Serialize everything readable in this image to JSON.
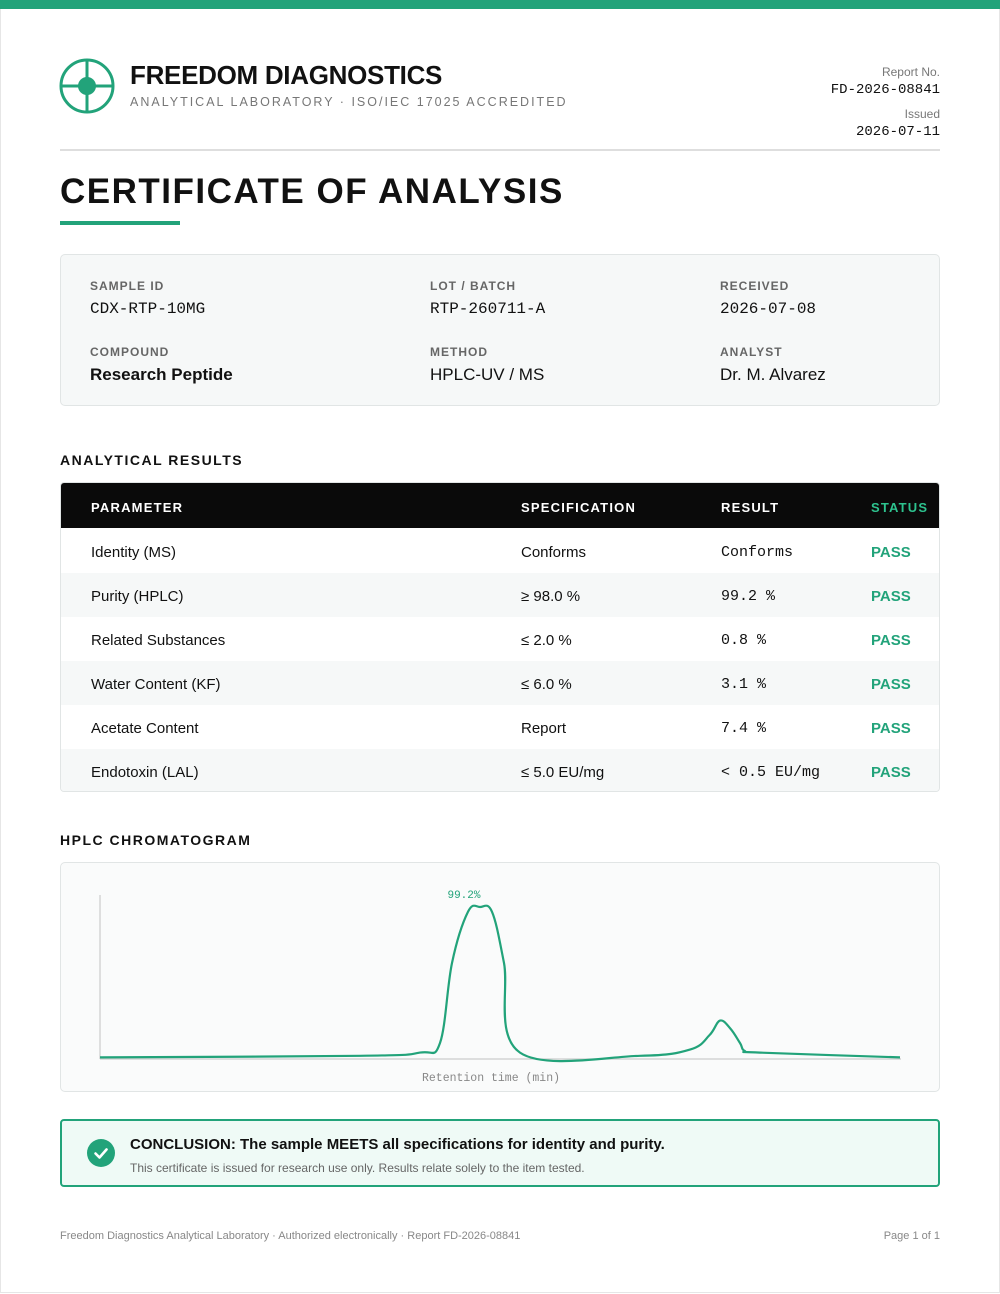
{
  "colors": {
    "accent": "#22a37a",
    "header_dark": "#0a0a0a",
    "pass": "#22a37a"
  },
  "header": {
    "brand_name": "FREEDOM DIAGNOSTICS",
    "brand_sub": "ANALYTICAL LABORATORY · ISO/IEC 17025 ACCREDITED",
    "logo_icon": "crosshair-icon",
    "report_no_label": "Report No.",
    "report_no": "FD-2026-08841",
    "issued_label": "Issued",
    "issued": "2026-07-11"
  },
  "title": "CERTIFICATE OF ANALYSIS",
  "sample": {
    "sample_id_label": "SAMPLE ID",
    "sample_id": "CDX-RTP-10MG",
    "lot_label": "LOT / BATCH",
    "lot": "RTP-260711-A",
    "received_label": "RECEIVED",
    "received": "2026-07-08",
    "compound_label": "COMPOUND",
    "compound": "Research Peptide",
    "method_label": "METHOD",
    "method": "HPLC-UV / MS",
    "analyst_label": "ANALYST",
    "analyst": "Dr. M. Alvarez"
  },
  "results": {
    "section_title": "ANALYTICAL RESULTS",
    "headers": [
      "PARAMETER",
      "SPECIFICATION",
      "RESULT",
      "STATUS"
    ],
    "rows": [
      {
        "parameter": "Identity (MS)",
        "spec": "Conforms",
        "result": "Conforms",
        "status": "PASS"
      },
      {
        "parameter": "Purity (HPLC)",
        "spec": "≥ 98.0 %",
        "result": "99.2 %",
        "status": "PASS"
      },
      {
        "parameter": "Related Substances",
        "spec": "≤ 2.0 %",
        "result": "0.8 %",
        "status": "PASS"
      },
      {
        "parameter": "Water Content (KF)",
        "spec": "≤ 6.0 %",
        "result": "3.1 %",
        "status": "PASS"
      },
      {
        "parameter": "Acetate Content",
        "spec": "Report",
        "result": "7.4 %",
        "status": "PASS"
      },
      {
        "parameter": "Endotoxin (LAL)",
        "spec": "≤ 5.0 EU/mg",
        "result": "< 0.5 EU/mg",
        "status": "PASS"
      }
    ]
  },
  "chromatogram": {
    "section_title": "HPLC CHROMATOGRAM"
  },
  "chart_data": {
    "type": "line",
    "title": "",
    "xlabel": "Retention time (min)",
    "ylabel": "",
    "grid": false,
    "peak_label": "99.2%",
    "x": [
      0,
      32.5,
      40,
      42.5,
      44,
      46,
      47.5,
      49,
      50.5,
      52.5,
      67.5,
      73.8,
      76.2,
      77.5,
      78.8,
      80,
      80.6,
      82.5,
      100
    ],
    "values": [
      1,
      2,
      4,
      10,
      60,
      92,
      95,
      92,
      60,
      4,
      2,
      6,
      15,
      24,
      19,
      10,
      5,
      4,
      1
    ],
    "ylim": [
      0,
      100
    ]
  },
  "conclusion": {
    "icon": "check-circle-icon",
    "title": "CONCLUSION: The sample MEETS all specifications for identity and purity.",
    "note": "This certificate is issued for research use only. Results relate solely to the item tested."
  },
  "footer": {
    "left": "Freedom Diagnostics Analytical Laboratory · Authorized electronically · Report FD-2026-08841",
    "right": "Page 1 of 1"
  }
}
